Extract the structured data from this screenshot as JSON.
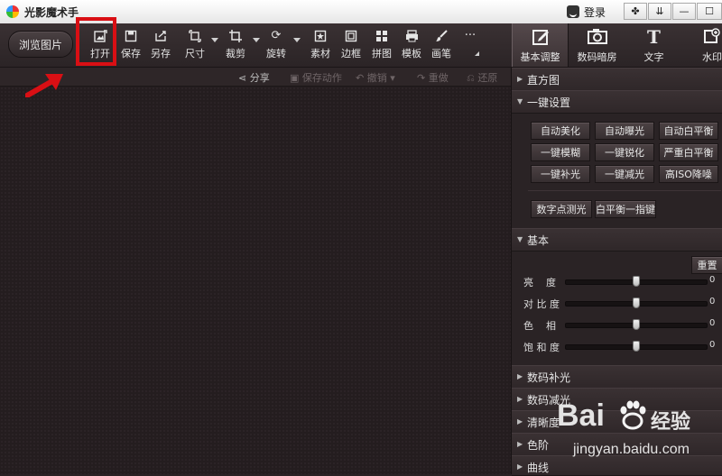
{
  "window": {
    "title": "光影魔术手",
    "login": "登录",
    "controls": [
      "✤",
      "⇊",
      "—",
      "☐",
      "✕"
    ]
  },
  "toolbar": {
    "browse": "浏览图片",
    "tools": [
      {
        "label": "打开",
        "icon": "open-image-icon"
      },
      {
        "label": "保存",
        "icon": "save-icon"
      },
      {
        "label": "另存",
        "icon": "save-as-icon"
      },
      {
        "label": "尺寸",
        "icon": "resize-icon"
      },
      {
        "label": "裁剪",
        "icon": "crop-icon"
      },
      {
        "label": "旋转",
        "icon": "rotate-icon"
      },
      {
        "label": "素材",
        "icon": "material-icon"
      },
      {
        "label": "边框",
        "icon": "border-icon"
      },
      {
        "label": "拼图",
        "icon": "collage-icon"
      },
      {
        "label": "模板",
        "icon": "template-icon"
      },
      {
        "label": "画笔",
        "icon": "brush-icon"
      },
      {
        "label": "···",
        "icon": "more-icon"
      }
    ]
  },
  "right_tabs": [
    {
      "label": "基本调整",
      "icon": "edit-square-icon",
      "active": true
    },
    {
      "label": "数码暗房",
      "icon": "camera-icon",
      "active": false
    },
    {
      "label": "文字",
      "icon": "text-t-icon",
      "active": false
    },
    {
      "label": "水印",
      "icon": "watermark-icon",
      "active": false
    }
  ],
  "subbar": {
    "share": "分享",
    "save_action": "保存动作",
    "undo": "撤销",
    "redo": "重做",
    "restore": "还原"
  },
  "panel": {
    "histogram": "直方图",
    "one_click": "一键设置",
    "one_click_buttons": [
      "自动美化",
      "自动曝光",
      "自动白平衡",
      "一键模糊",
      "一键锐化",
      "严重白平衡",
      "一键补光",
      "一键减光",
      "高ISO降噪"
    ],
    "extra_buttons": [
      "数字点测光",
      "白平衡一指键"
    ],
    "basic": "基本",
    "reset": "重置",
    "sliders": [
      {
        "label": "亮    度",
        "value": 0,
        "level": 0.5
      },
      {
        "label": "对 比 度",
        "value": 0,
        "level": 0.5
      },
      {
        "label": "色    相",
        "value": 0,
        "level": 0.5
      },
      {
        "label": "饱 和 度",
        "value": 0,
        "level": 0.5
      }
    ],
    "more_sections": [
      "数码补光",
      "数码减光",
      "清晰度",
      "色阶",
      "曲线"
    ]
  },
  "watermark": {
    "brand": "Bai",
    "cn": "经验",
    "url": "jingyan.baidu.com"
  },
  "colors": {
    "highlight_red": "#d90f14",
    "bg_dark": "#241d1f"
  }
}
